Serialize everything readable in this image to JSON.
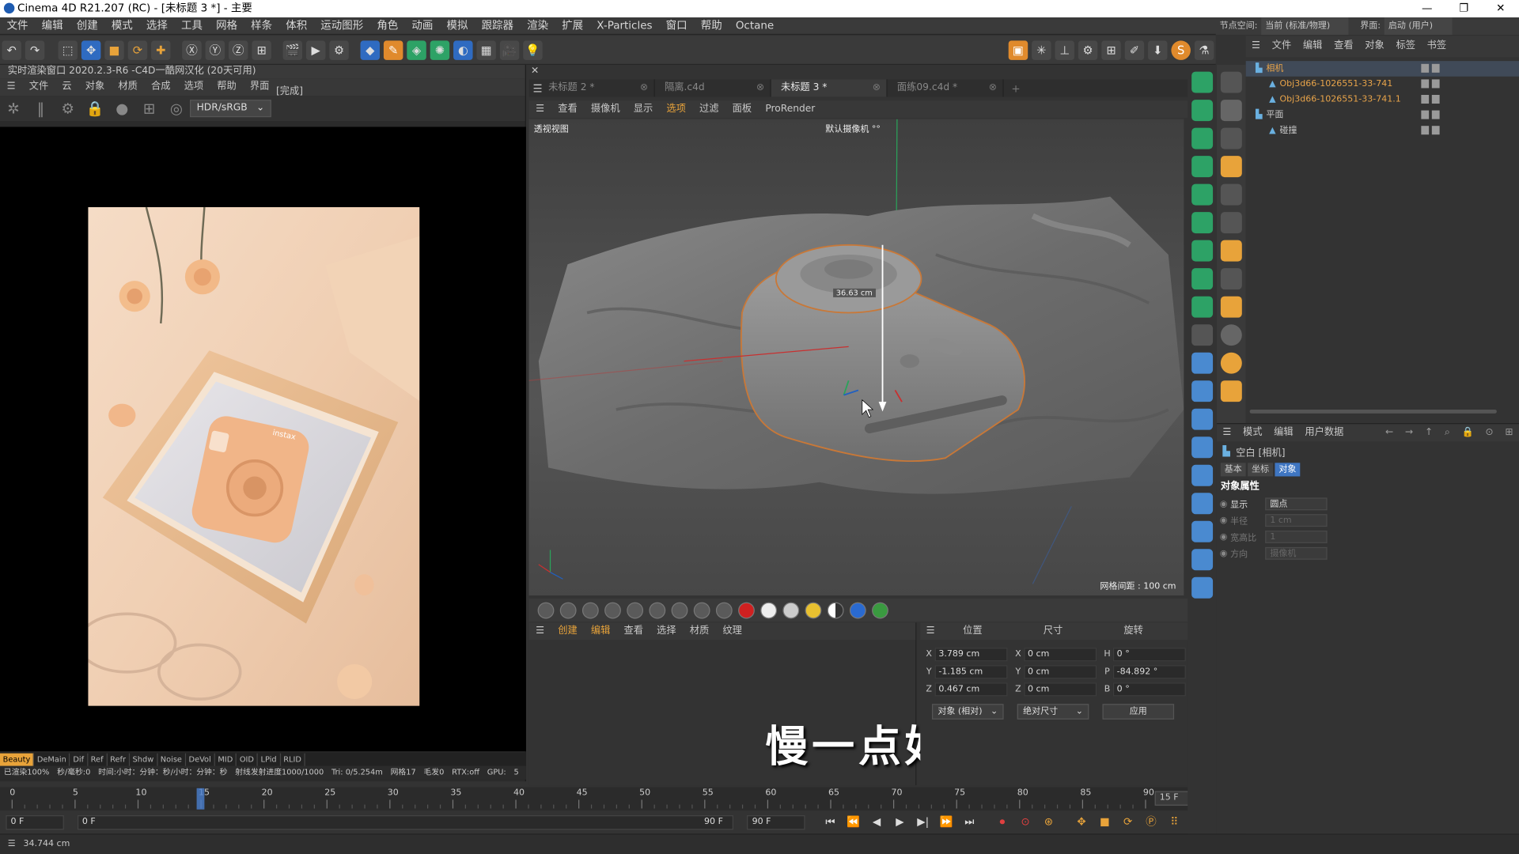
{
  "window": {
    "title": "Cinema 4D R21.207 (RC) - [未标题 3 *] - 主要"
  },
  "menubar": [
    "文件",
    "编辑",
    "创建",
    "模式",
    "选择",
    "工具",
    "网格",
    "样条",
    "体积",
    "运动图形",
    "角色",
    "动画",
    "模拟",
    "跟踪器",
    "渲染",
    "扩展",
    "X-Particles",
    "窗口",
    "帮助",
    "Octane"
  ],
  "node_space": {
    "label": "节点空间:",
    "value": "当前 (标准/物理)",
    "layout": "界面:",
    "layout_value": "启动 (用户)"
  },
  "live_render": {
    "title": "实时渲染窗口 2020.2.3-R6   -C4D一酷网汉化 (20天可用)",
    "menu": [
      "文件",
      "云",
      "对象",
      "材质",
      "合成",
      "选项",
      "帮助",
      "界面"
    ],
    "status_done": "[完成]",
    "colorspace": "HDR/sRGB",
    "passes": [
      "Beauty",
      "DeMain",
      "Dif",
      "Ref",
      "Refr",
      "Shdw",
      "Noise",
      "DeVol",
      "MID",
      "OID",
      "LPid",
      "RLID"
    ],
    "info": [
      "已渲染100%",
      "秒/毫秒:0",
      "时间:小时：分钟：秒/小时：分钟：秒",
      "射线发射进度1000/1000",
      "Tri: 0/5.254m",
      "网格17",
      "毛发0",
      "RTX:off",
      "GPU:",
      "5"
    ]
  },
  "photo": {
    "camera_brand": "instax"
  },
  "viewport": {
    "tabs": [
      {
        "label": "未标题 2 *",
        "active": false
      },
      {
        "label": "隔离.c4d",
        "active": false
      },
      {
        "label": "未标题 3 *",
        "active": true
      },
      {
        "label": "面练09.c4d *",
        "active": false
      }
    ],
    "menu": [
      "查看",
      "摄像机",
      "显示",
      "选项",
      "过滤",
      "面板",
      "ProRender"
    ],
    "view_name": "透视视图",
    "camera_name": "默认摄像机 °°",
    "measure": "36.63 cm",
    "grid_spacing": "网格间距 : 100 cm"
  },
  "subtitle": "慢一点好",
  "material_menu": [
    "创建",
    "编辑",
    "查看",
    "选择",
    "材质",
    "纹理"
  ],
  "coords": {
    "headers": [
      "位置",
      "尺寸",
      "旋转"
    ],
    "rows": [
      {
        "axis": "X",
        "pos": "3.789 cm",
        "size_axis": "X",
        "size": "0 cm",
        "rot_axis": "H",
        "rot": "0 °"
      },
      {
        "axis": "Y",
        "pos": "-1.185 cm",
        "size_axis": "Y",
        "size": "0 cm",
        "rot_axis": "P",
        "rot": "-84.892 °"
      },
      {
        "axis": "Z",
        "pos": "0.467 cm",
        "size_axis": "Z",
        "size": "0 cm",
        "rot_axis": "B",
        "rot": "0 °"
      }
    ],
    "mode": "对象 (相对)",
    "size_mode": "绝对尺寸",
    "apply": "应用"
  },
  "timeline": {
    "ticks": [
      "0",
      "5",
      "10",
      "15",
      "20",
      "25",
      "30",
      "35",
      "40",
      "45",
      "50",
      "55",
      "60",
      "65",
      "70",
      "75",
      "80",
      "85",
      "90"
    ],
    "current": 15,
    "current_frame": "15 F",
    "start": "0 F",
    "range_start": "0 F",
    "range_end": "90 F",
    "end": "90 F"
  },
  "status": "34.744 cm",
  "objects": {
    "menu": [
      "文件",
      "编辑",
      "查看",
      "对象",
      "标签",
      "书签"
    ],
    "items": [
      {
        "name": "相机",
        "indent": 0,
        "color": "#e8a44a"
      },
      {
        "name": "Obj3d66-1026551-33-741",
        "indent": 1,
        "color": "#e8a44a"
      },
      {
        "name": "Obj3d66-1026551-33-741.1",
        "indent": 1,
        "color": "#e8a44a"
      },
      {
        "name": "平面",
        "indent": 0,
        "color": "#c8c8c8"
      },
      {
        "name": "碰撞",
        "indent": 1,
        "color": "#c8c8c8"
      }
    ]
  },
  "attributes": {
    "menu": [
      "模式",
      "编辑",
      "用户数据"
    ],
    "object_name": "空白 [相机]",
    "tabs": [
      "基本",
      "坐标",
      "对象"
    ],
    "section": "对象属性",
    "fields": [
      {
        "label": "显示",
        "value": "圆点"
      },
      {
        "label": "半径",
        "value": "1 cm"
      },
      {
        "label": "宽高比",
        "value": "1"
      },
      {
        "label": "方向",
        "value": "摄像机"
      }
    ]
  }
}
